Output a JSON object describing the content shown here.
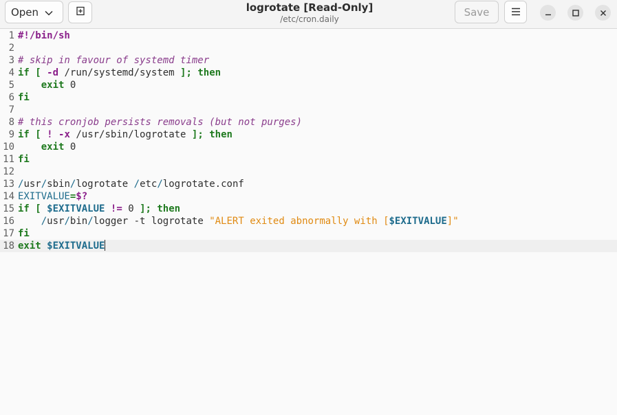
{
  "header": {
    "open_label": "Open",
    "title": "logrotate [Read-Only]",
    "subtitle": "/etc/cron.daily",
    "save_label": "Save",
    "icons": {
      "open_dropdown": "chevron-down-icon",
      "new_tab": "new-tab-icon",
      "menu": "hamburger-menu-icon",
      "minimize": "minimize-icon",
      "maximize": "maximize-icon",
      "close": "close-icon"
    }
  },
  "editor": {
    "current_line": 18,
    "lines": [
      {
        "num": "1",
        "seg": [
          {
            "t": "#!/bin/sh",
            "c": "op"
          }
        ]
      },
      {
        "num": "2",
        "seg": []
      },
      {
        "num": "3",
        "seg": [
          {
            "t": "# skip in favour of systemd timer",
            "c": "cmt"
          }
        ]
      },
      {
        "num": "4",
        "seg": [
          {
            "t": "if",
            "c": "kw"
          },
          {
            "t": " "
          },
          {
            "t": "[",
            "c": "kw"
          },
          {
            "t": " "
          },
          {
            "t": "-d",
            "c": "op"
          },
          {
            "t": " /run/systemd/system "
          },
          {
            "t": "];",
            "c": "kw"
          },
          {
            "t": " "
          },
          {
            "t": "then",
            "c": "kw"
          }
        ]
      },
      {
        "num": "5",
        "seg": [
          {
            "t": "    "
          },
          {
            "t": "exit",
            "c": "kw"
          },
          {
            "t": " 0"
          }
        ]
      },
      {
        "num": "6",
        "seg": [
          {
            "t": "fi",
            "c": "kw"
          }
        ]
      },
      {
        "num": "7",
        "seg": []
      },
      {
        "num": "8",
        "seg": [
          {
            "t": "# this cronjob persists removals (but not purges)",
            "c": "cmt"
          }
        ]
      },
      {
        "num": "9",
        "seg": [
          {
            "t": "if",
            "c": "kw"
          },
          {
            "t": " "
          },
          {
            "t": "[",
            "c": "kw"
          },
          {
            "t": " "
          },
          {
            "t": "!",
            "c": "op"
          },
          {
            "t": " "
          },
          {
            "t": "-x",
            "c": "op"
          },
          {
            "t": " /usr/sbin/logrotate "
          },
          {
            "t": "];",
            "c": "kw"
          },
          {
            "t": " "
          },
          {
            "t": "then",
            "c": "kw"
          }
        ]
      },
      {
        "num": "10",
        "seg": [
          {
            "t": "    "
          },
          {
            "t": "exit",
            "c": "kw"
          },
          {
            "t": " 0"
          }
        ]
      },
      {
        "num": "11",
        "seg": [
          {
            "t": "fi",
            "c": "kw"
          }
        ]
      },
      {
        "num": "12",
        "seg": []
      },
      {
        "num": "13",
        "seg": [
          {
            "t": "/",
            "c": "pu"
          },
          {
            "t": "usr"
          },
          {
            "t": "/",
            "c": "pu"
          },
          {
            "t": "sbin"
          },
          {
            "t": "/",
            "c": "pu"
          },
          {
            "t": "logrotate "
          },
          {
            "t": "/",
            "c": "pu"
          },
          {
            "t": "etc"
          },
          {
            "t": "/",
            "c": "pu"
          },
          {
            "t": "logrotate.conf"
          }
        ]
      },
      {
        "num": "14",
        "seg": [
          {
            "t": "EXITVALUE",
            "c": "pu"
          },
          {
            "t": "=",
            "c": "kw"
          },
          {
            "t": "$?",
            "c": "op"
          }
        ]
      },
      {
        "num": "15",
        "seg": [
          {
            "t": "if",
            "c": "kw"
          },
          {
            "t": " "
          },
          {
            "t": "[",
            "c": "kw"
          },
          {
            "t": " "
          },
          {
            "t": "$EXITVALUE",
            "c": "var"
          },
          {
            "t": " "
          },
          {
            "t": "!=",
            "c": "op"
          },
          {
            "t": " 0 "
          },
          {
            "t": "];",
            "c": "kw"
          },
          {
            "t": " "
          },
          {
            "t": "then",
            "c": "kw"
          }
        ]
      },
      {
        "num": "16",
        "seg": [
          {
            "t": "    "
          },
          {
            "t": "/",
            "c": "pu"
          },
          {
            "t": "usr"
          },
          {
            "t": "/",
            "c": "pu"
          },
          {
            "t": "bin"
          },
          {
            "t": "/",
            "c": "pu"
          },
          {
            "t": "logger -t logrotate "
          },
          {
            "t": "\"ALERT exited abnormally with [",
            "c": "str"
          },
          {
            "t": "$EXITVALUE",
            "c": "var"
          },
          {
            "t": "]\"",
            "c": "str"
          }
        ]
      },
      {
        "num": "17",
        "seg": [
          {
            "t": "fi",
            "c": "kw"
          }
        ]
      },
      {
        "num": "18",
        "seg": [
          {
            "t": "exit",
            "c": "kw"
          },
          {
            "t": " "
          },
          {
            "t": "$EXITVALUE",
            "c": "var"
          }
        ],
        "cursor": true
      }
    ]
  }
}
